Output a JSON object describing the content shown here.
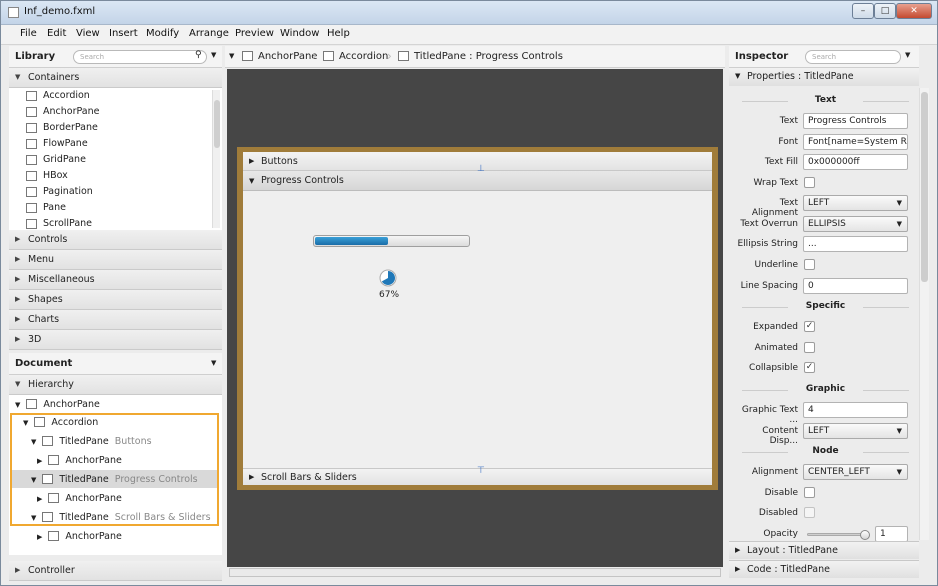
{
  "window": {
    "title": "Inf_demo.fxml",
    "controls": {
      "minimize": "–",
      "maximize": "□",
      "close": "✕"
    }
  },
  "menu": [
    "File",
    "Edit",
    "View",
    "Insert",
    "Modify",
    "Arrange",
    "Preview",
    "Window",
    "Help"
  ],
  "library": {
    "title": "Library",
    "search_placeholder": "Search",
    "containers_label": "Containers",
    "containers": [
      "Accordion",
      "AnchorPane",
      "BorderPane",
      "FlowPane",
      "GridPane",
      "HBox",
      "Pagination",
      "Pane",
      "ScrollPane"
    ],
    "sections": [
      "Controls",
      "Menu",
      "Miscellaneous",
      "Shapes",
      "Charts",
      "3D"
    ]
  },
  "document": {
    "title": "Document",
    "hierarchy_label": "Hierarchy",
    "tree": [
      {
        "label": "AnchorPane",
        "sub": ""
      },
      {
        "label": "Accordion",
        "sub": ""
      },
      {
        "label": "TitledPane",
        "sub": "Buttons"
      },
      {
        "label": "AnchorPane",
        "sub": ""
      },
      {
        "label": "TitledPane",
        "sub": "Progress Controls"
      },
      {
        "label": "AnchorPane",
        "sub": ""
      },
      {
        "label": "TitledPane",
        "sub": "Scroll Bars & Sliders"
      },
      {
        "label": "AnchorPane",
        "sub": ""
      }
    ],
    "controller_label": "Controller"
  },
  "breadcrumb": [
    "AnchorPane",
    "Accordion",
    "TitledPane : Progress Controls"
  ],
  "canvas": {
    "panes": [
      "Buttons",
      "Progress Controls",
      "Scroll Bars & Sliders"
    ],
    "progress_bar_value": 0.48,
    "progress_indicator_label": "67%",
    "progress_indicator_value": 0.67
  },
  "inspector": {
    "title": "Inspector",
    "search_placeholder": "Search",
    "properties_title": "Properties : TitledPane",
    "sections": {
      "text": "Text",
      "specific": "Specific",
      "graphic": "Graphic",
      "node": "Node"
    },
    "text_props": [
      {
        "label": "Text",
        "value": "Progress Controls"
      },
      {
        "label": "Font",
        "value": "Font[name=System Regu"
      },
      {
        "label": "Text Fill",
        "value": "0x000000ff"
      },
      {
        "label": "Wrap Text",
        "value": ""
      },
      {
        "label": "Text Alignment",
        "value": "LEFT"
      },
      {
        "label": "Text Overrun",
        "value": "ELLIPSIS"
      },
      {
        "label": "Ellipsis String",
        "value": "..."
      },
      {
        "label": "Underline",
        "value": ""
      },
      {
        "label": "Line Spacing",
        "value": "0"
      }
    ],
    "specific_props": [
      {
        "label": "Expanded",
        "checked": "✓"
      },
      {
        "label": "Animated",
        "checked": ""
      },
      {
        "label": "Collapsible",
        "checked": "✓"
      }
    ],
    "graphic_props": [
      {
        "label": "Graphic Text ...",
        "value": "4"
      },
      {
        "label": "Content Disp...",
        "value": "LEFT"
      }
    ],
    "node_props": [
      {
        "label": "Alignment",
        "value": "CENTER_LEFT"
      },
      {
        "label": "Disable",
        "value": ""
      },
      {
        "label": "Disabled",
        "value": ""
      },
      {
        "label": "Opacity",
        "value": "1"
      }
    ],
    "opacity_value": 1,
    "layout_title": "Layout : TitledPane",
    "code_title": "Code : TitledPane"
  }
}
